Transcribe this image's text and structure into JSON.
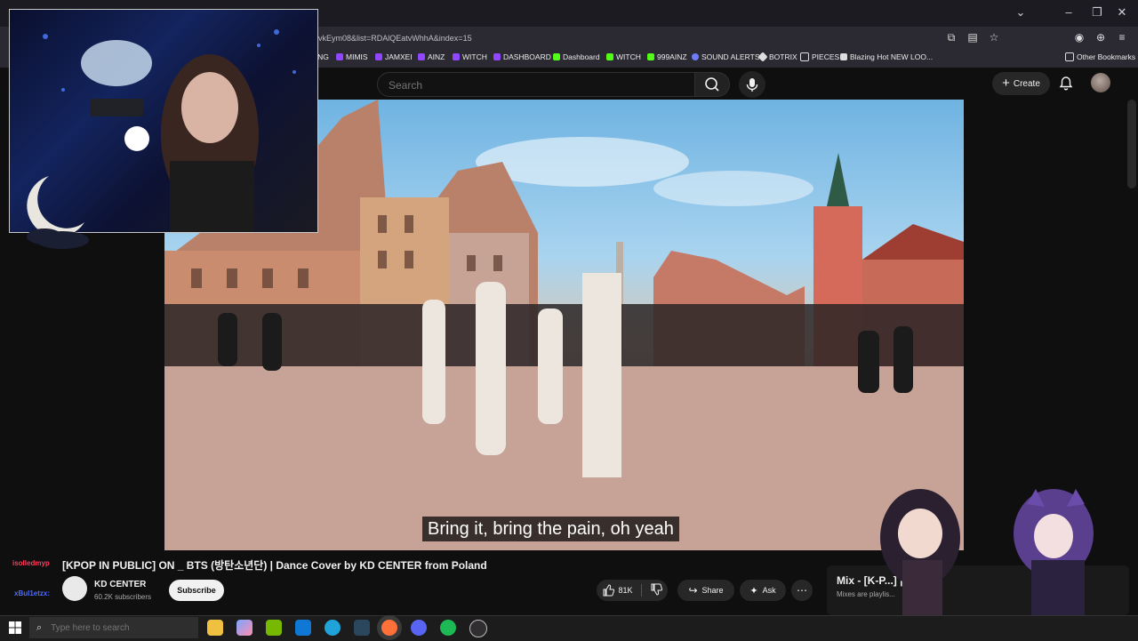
{
  "browser": {
    "url": "w/PGvkEym08&list=RDAlQEatvWhhA&index=15",
    "window_controls": [
      "chevron-down",
      "minimize",
      "restore",
      "close"
    ],
    "bookmarks": [
      {
        "label": "ANING",
        "color": "#bbbbbb"
      },
      {
        "label": "MIMIS",
        "color": "#9146ff"
      },
      {
        "label": "JAMXEI",
        "color": "#9146ff"
      },
      {
        "label": "AINZ",
        "color": "#9146ff"
      },
      {
        "label": "WITCH",
        "color": "#9146ff"
      },
      {
        "label": "DASHBOARD",
        "color": "#9146ff"
      },
      {
        "label": "Dashboard",
        "color": "#53fc18"
      },
      {
        "label": "WITCH",
        "color": "#53fc18"
      },
      {
        "label": "999AINZ",
        "color": "#53fc18"
      },
      {
        "label": "SOUND ALERTS",
        "color": "#6f7bff"
      },
      {
        "label": "BOTRIX",
        "color": "#dddddd"
      },
      {
        "label": "PIECES",
        "color": "#dddddd"
      },
      {
        "label": "Blazing Hot NEW LOO...",
        "color": "#dddddd"
      }
    ],
    "other_bookmarks": "Other Bookmarks"
  },
  "youtube": {
    "search_placeholder": "Search",
    "create_label": "Create"
  },
  "video": {
    "subtitle": "Bring it, bring the pain, oh yeah",
    "title": "[KPOP IN PUBLIC] ON _ BTS (방탄소년단) | Dance Cover by KD CENTER from Poland",
    "channel_name": "KD CENTER",
    "subscribers": "60.2K subscribers",
    "subscribe_label": "Subscribe",
    "likes": "81K",
    "share_label": "Share",
    "ask_label": "Ask"
  },
  "mix": {
    "title": "Mix - [K-P...] | TIMS...",
    "subtitle": "Mixes are playlis..."
  },
  "overlay": {
    "chat_user_1": "isolledmyp",
    "chat_user_2": "xBul1etzx:"
  },
  "taskbar": {
    "search_placeholder": "Type here to search",
    "apps": [
      {
        "name": "file-explorer",
        "color": "#f0c040"
      },
      {
        "name": "copilot",
        "color": "#7aa6ff"
      },
      {
        "name": "nvidia",
        "color": "#76b900"
      },
      {
        "name": "outlook",
        "color": "#0f78d4"
      },
      {
        "name": "edge",
        "color": "#1fa3d9"
      },
      {
        "name": "steam",
        "color": "#1b2838"
      },
      {
        "name": "firefox",
        "color": "#ff7139"
      },
      {
        "name": "discord",
        "color": "#5865f2"
      },
      {
        "name": "spotify",
        "color": "#1db954"
      },
      {
        "name": "obs",
        "color": "#302e31"
      }
    ]
  }
}
